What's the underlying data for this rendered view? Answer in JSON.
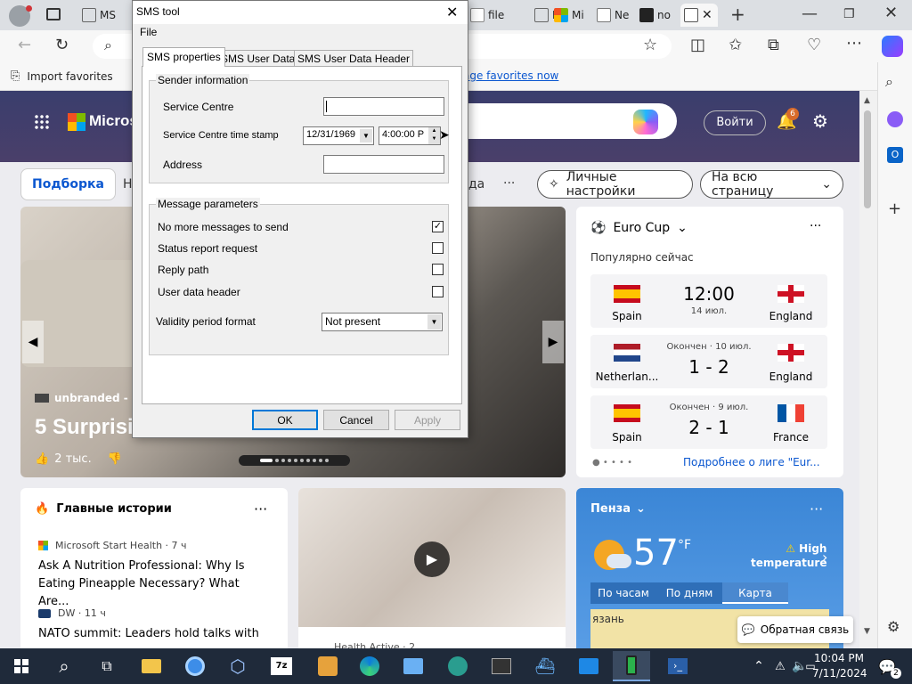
{
  "browser": {
    "tabs": [
      {
        "label": "MS",
        "color": "#7b7b7b"
      },
      {
        "label": "MS",
        "color": "#7b7b7b"
      },
      {
        "label": "file",
        "color": "#9a9a9a"
      },
      {
        "label": "MS",
        "color": "#7b7b7b"
      },
      {
        "label": "Mi",
        "color": "#f25022"
      },
      {
        "label": "Ne",
        "color": "#8a8a8a"
      },
      {
        "label": "no",
        "color": "#333"
      }
    ],
    "fav_import": "Import favorites",
    "fav_manage": "age favorites now"
  },
  "msn": {
    "brand": "Micros",
    "login": "Войти",
    "notif_count": "6",
    "tabs": {
      "picks": "Подборка",
      "n": "Н",
      "da": "да",
      "more": "···"
    },
    "personal": "Личные настройки",
    "fullpage": "На всю страницу",
    "hero": {
      "source": "unbranded - Life",
      "title": "5 Surprisin",
      "likes": "2 тыс."
    },
    "top_stories": {
      "heading": "Главные истории",
      "items": [
        {
          "source": "Microsoft Start Health · 7 ч",
          "title": "Ask A Nutrition Professional: Why Is Eating Pineapple Necessary? What Are..."
        },
        {
          "source": "DW · 11 ч",
          "title": "NATO summit: Leaders hold talks with"
        }
      ]
    },
    "video_source": "Health Active · 2",
    "euro": {
      "title": "Euro Cup",
      "popular": "Популярно сейчас",
      "matches": [
        {
          "team1": "Spain",
          "team2": "England",
          "status": "",
          "score": "12:00",
          "sub": "14 июл."
        },
        {
          "team1": "Netherlan...",
          "team2": "England",
          "status": "Окончен · 10 июл.",
          "score": "1 - 2",
          "sub": ""
        },
        {
          "team1": "Spain",
          "team2": "France",
          "status": "Окончен · 9 июл.",
          "score": "2 - 1",
          "sub": ""
        }
      ],
      "more": "Подробнее о лиге \"Eur..."
    },
    "weather": {
      "city": "Пенза",
      "temp": "57",
      "unit": "°F",
      "alert1": "High",
      "alert2": "temperature",
      "tab_hours": "По часам",
      "tab_days": "По дням",
      "tab_map": "Карта",
      "map_label": "язань"
    },
    "feedback": "Обратная связь"
  },
  "dialog": {
    "title": "SMS tool",
    "menu_file": "File",
    "tabs": [
      "SMS properties",
      "SMS User Data",
      "SMS User Data Header"
    ],
    "sender_group": "Sender information",
    "service_centre": "Service Centre",
    "service_centre_value": "",
    "timestamp_label": "Service Centre time stamp",
    "date_value": "12/31/1969",
    "time_value": "4:00:00 P",
    "address": "Address",
    "address_value": "",
    "msg_group": "Message parameters",
    "no_more": "No more messages to send",
    "no_more_checked": true,
    "status_report": "Status report request",
    "reply_path": "Reply path",
    "udh": "User data header",
    "validity_label": "Validity period format",
    "validity_value": "Not present",
    "ok": "OK",
    "cancel": "Cancel",
    "apply": "Apply"
  },
  "taskbar": {
    "time": "10:04 PM",
    "date": "7/11/2024",
    "notif": "2"
  }
}
